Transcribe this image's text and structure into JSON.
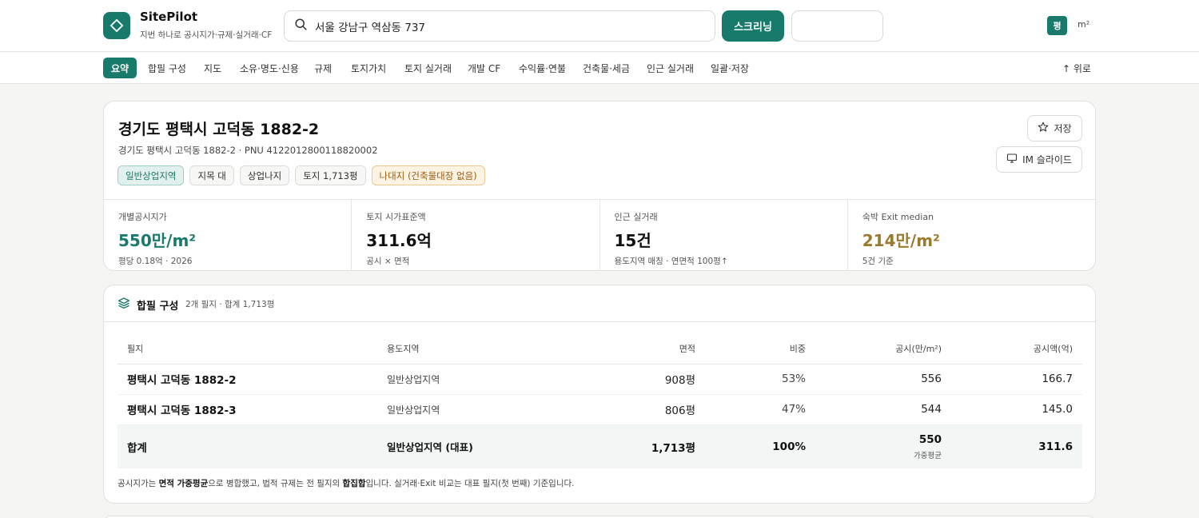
{
  "brand": {
    "name": "SitePilot",
    "subtitle": "지번 하나로 공시지가·규제·실거래·CF"
  },
  "search": {
    "value": "서울 강남구 역삼동 737"
  },
  "header": {
    "screening_button": "스크리닝",
    "unit_pyeong": "평",
    "unit_m2": "m²"
  },
  "nav": {
    "tabs": [
      "요약",
      "합필 구성",
      "지도",
      "소유·명도·신용",
      "규제",
      "토지가치",
      "토지 실거래",
      "개발 CF",
      "수익률·연불",
      "건축물·세금",
      "인근 실거래",
      "일괄·저장"
    ],
    "active": "요약",
    "top_link": "↑ 위로"
  },
  "summary": {
    "title": "경기도 평택시 고덕동 1882-2",
    "subtitle": "경기도 평택시 고덕동 1882-2 · PNU 4122012800118820002",
    "tags": [
      "일반상업지역",
      "지목 대",
      "상업나지",
      "토지 1,713평",
      "나대지 (건축물대장 없음)"
    ],
    "save_label": "저장",
    "im_label": "IM 슬라이드",
    "metrics": [
      {
        "label": "개별공시지가",
        "value": "550만/m²",
        "note": "평당 0.18억 · 2026"
      },
      {
        "label": "토지 시가표준액",
        "value": "311.6억",
        "note": "공시 × 면적"
      },
      {
        "label": "인근 실거래",
        "value": "15건",
        "note": "용도지역 매칭 · 연면적 100평↑"
      },
      {
        "label": "숙박 Exit median",
        "value": "214만/m²",
        "note": "5건 기준"
      }
    ]
  },
  "parcels": {
    "title": "합필 구성",
    "meta": "2개 필지 · 합계 1,713평",
    "columns": [
      "필지",
      "용도지역",
      "면적",
      "비중",
      "공시(만/m²)",
      "공시액(억)"
    ],
    "rows": [
      [
        "평택시 고덕동 1882-2",
        "일반상업지역",
        "908평",
        "53%",
        "556",
        "166.7"
      ],
      [
        "평택시 고덕동 1882-3",
        "일반상업지역",
        "806평",
        "47%",
        "544",
        "145.0"
      ]
    ],
    "total": {
      "label": "합계",
      "zone": "일반상업지역 (대표)",
      "area": "1,713평",
      "ratio": "100%",
      "price": "550",
      "price_note": "가중평균",
      "amount": "311.6"
    },
    "footnote": {
      "p1": "공시지가는 ",
      "b1": "면적 가중평균",
      "p2": "으로 병합했고, 법적 규제는 전 필지의 ",
      "b2": "합집합",
      "p3": "입니다. 실거래·Exit 비교는 대표 필지(첫 번째) 기준입니다."
    }
  },
  "colors": {
    "accent": "#187a6a",
    "gold": "#9a7a2e",
    "warn": "#9a5a0e"
  }
}
